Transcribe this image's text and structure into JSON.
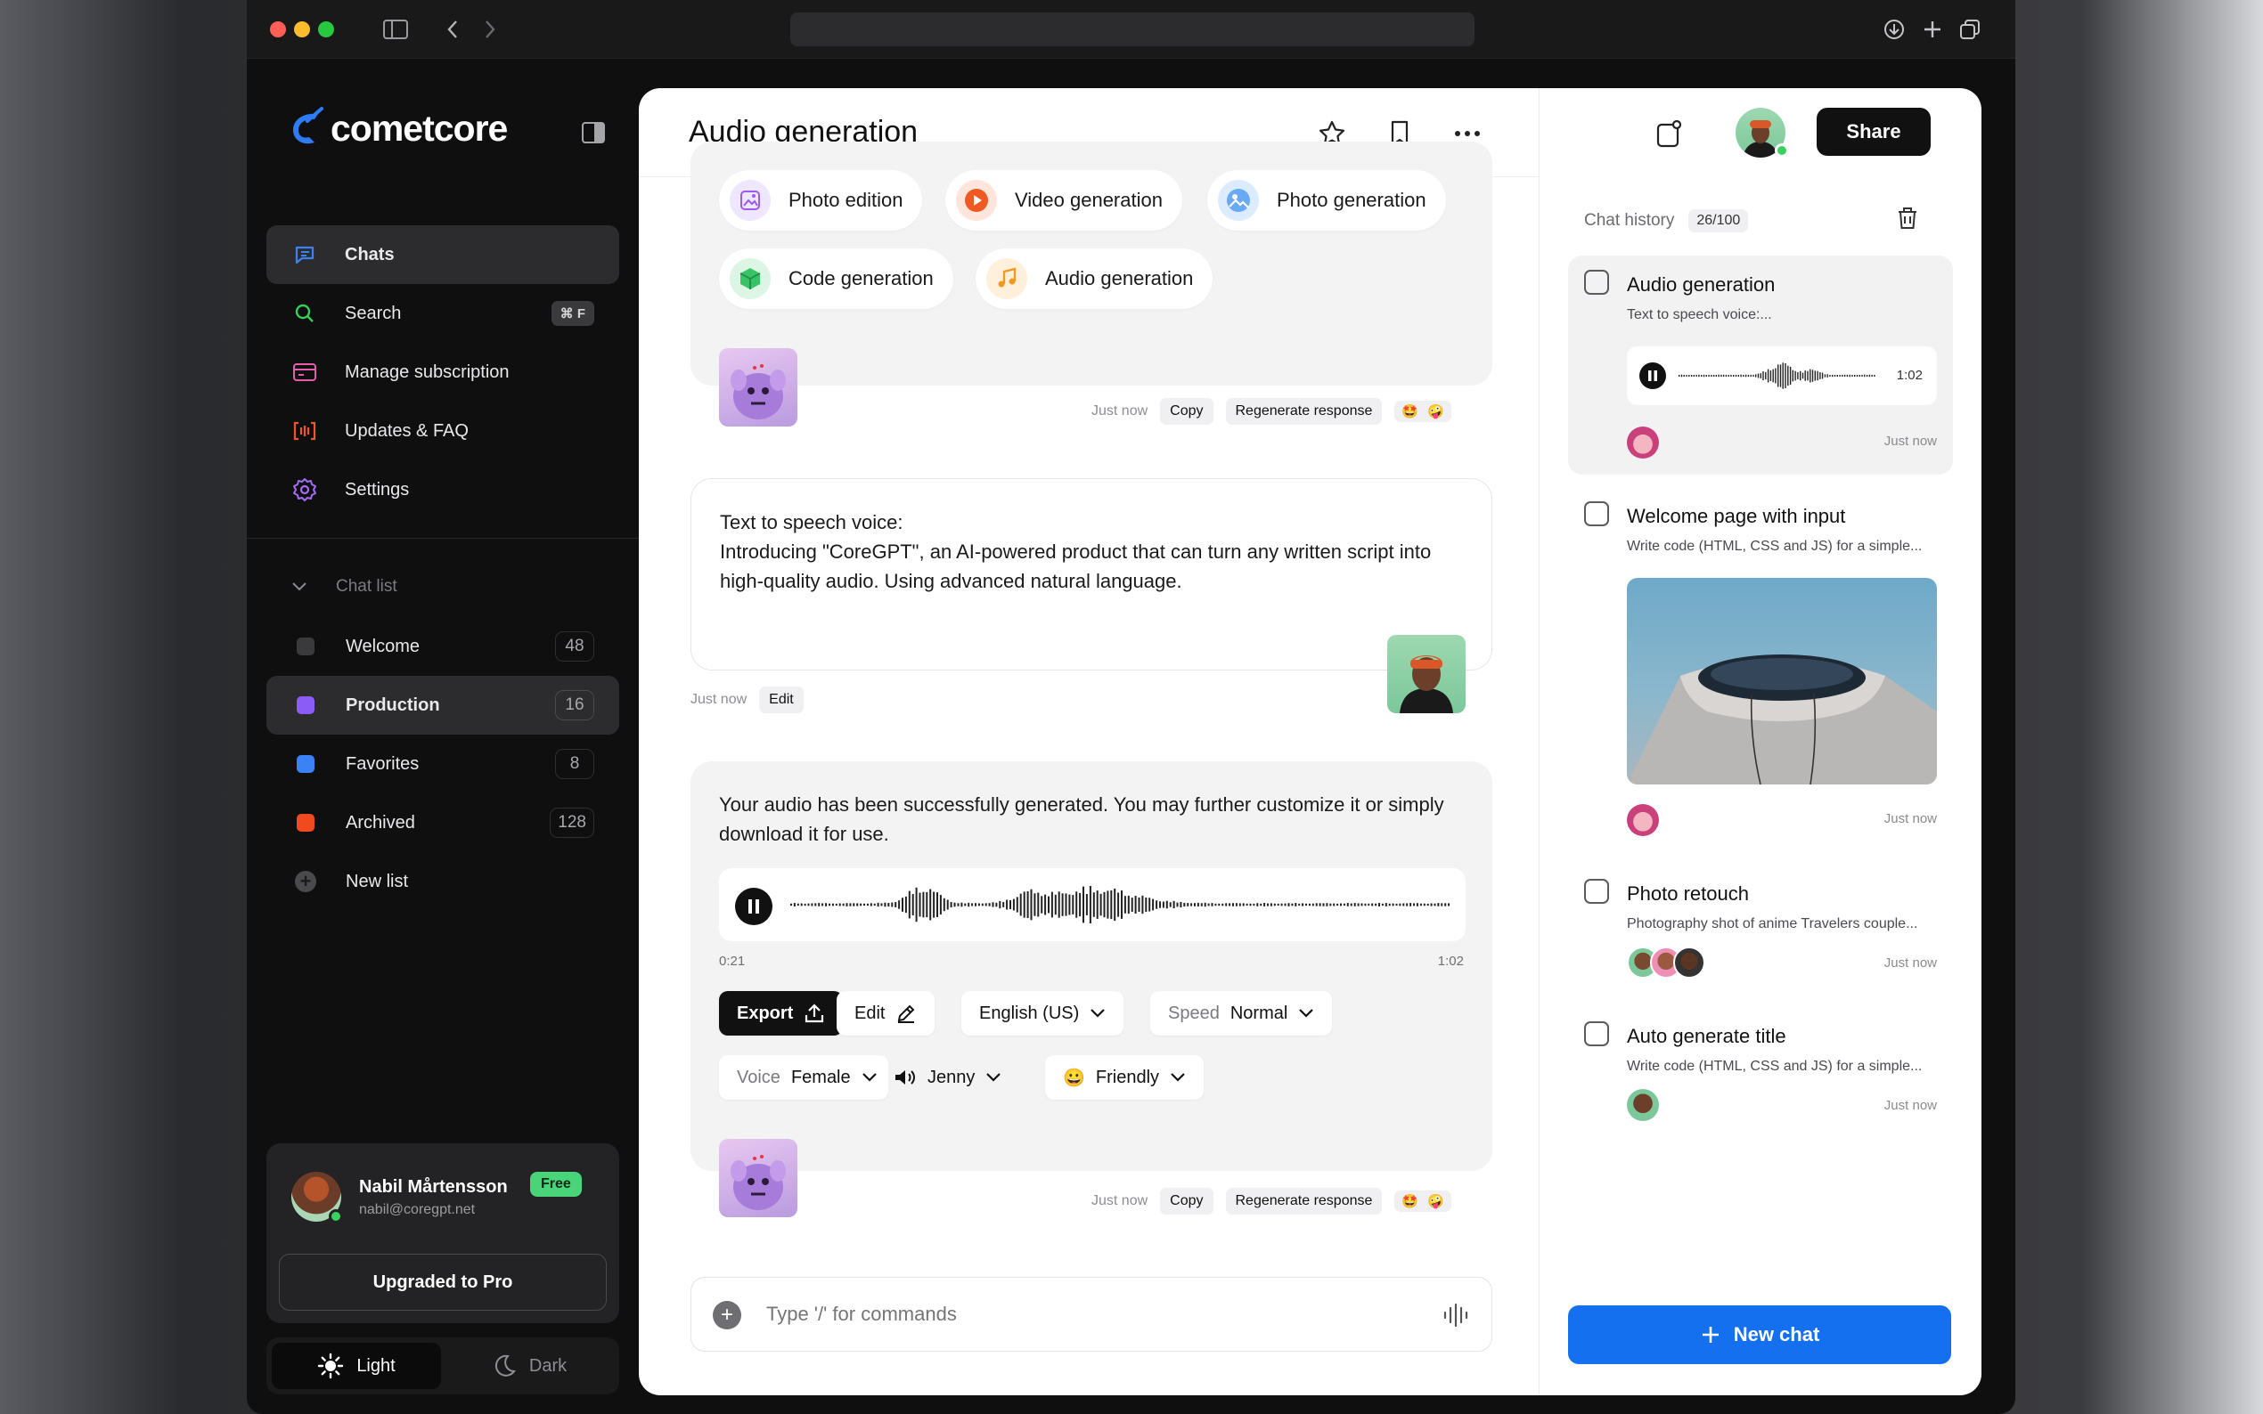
{
  "sidebar": {
    "brand": "cometcore",
    "nav": [
      {
        "label": "Chats",
        "icon": "chat-icon"
      },
      {
        "label": "Search",
        "icon": "search-icon",
        "shortcut": "⌘ F"
      },
      {
        "label": "Manage subscription",
        "icon": "card-icon"
      },
      {
        "label": "Updates & FAQ",
        "icon": "updates-icon"
      },
      {
        "label": "Settings",
        "icon": "gear-icon"
      }
    ],
    "chat_list_label": "Chat list",
    "lists": [
      {
        "label": "Welcome",
        "count": "48",
        "color": "#3a3a3c"
      },
      {
        "label": "Production",
        "count": "16",
        "color": "#8b5cf6"
      },
      {
        "label": "Favorites",
        "count": "8",
        "color": "#3b82f6"
      },
      {
        "label": "Archived",
        "count": "128",
        "color": "#f04a1f"
      }
    ],
    "new_list": "New list",
    "user": {
      "name": "Nabil Mårtensson",
      "email": "nabil@coregpt.net",
      "plan": "Free",
      "upgrade_label": "Upgraded to Pro"
    },
    "theme": {
      "light": "Light",
      "dark": "Dark"
    }
  },
  "main": {
    "title": "Audio generation",
    "chips": [
      {
        "label": "Photo edition",
        "icon": "photo-edit-icon"
      },
      {
        "label": "Video generation",
        "icon": "video-icon"
      },
      {
        "label": "Photo generation",
        "icon": "photo-gen-icon"
      },
      {
        "label": "Code generation",
        "icon": "code-icon"
      },
      {
        "label": "Audio generation",
        "icon": "music-icon"
      }
    ],
    "meta1": {
      "time": "Just now",
      "copy": "Copy",
      "regen": "Regenerate response"
    },
    "user_message": {
      "line1": "Text to speech voice:",
      "body": "Introducing \"CoreGPT\", an AI-powered product that can turn any written script into high-quality audio. Using advanced natural language.",
      "time": "Just now",
      "edit": "Edit"
    },
    "audio": {
      "text": "Your audio has been successfully generated. You may further customize it or simply download it for use.",
      "current": "0:21",
      "duration": "1:02",
      "progress": 0.34,
      "export": "Export",
      "edit": "Edit",
      "language": "English (US)",
      "speed_label": "Speed",
      "speed": "Normal",
      "voice_label": "Voice",
      "voice": "Female",
      "speaker": "Jenny",
      "tone": "Friendly"
    },
    "meta2": {
      "time": "Just now",
      "copy": "Copy",
      "regen": "Regenerate response"
    },
    "composer": {
      "placeholder": "Type '/' for commands"
    }
  },
  "right": {
    "share": "Share",
    "history_label": "Chat history",
    "history_count": "26/100",
    "items": [
      {
        "title": "Audio generation",
        "sub": "Text to speech voice:...",
        "duration": "1:02",
        "time": "Just now"
      },
      {
        "title": "Welcome page with input",
        "sub": "Write code (HTML, CSS and JS) for a simple...",
        "time": "Just now"
      },
      {
        "title": "Photo retouch",
        "sub": "Photography shot of anime Travelers couple...",
        "time": "Just now"
      },
      {
        "title": "Auto generate title",
        "sub": "Write code (HTML, CSS and JS) for a simple...",
        "time": "Just now"
      }
    ],
    "new_chat": "New chat"
  }
}
